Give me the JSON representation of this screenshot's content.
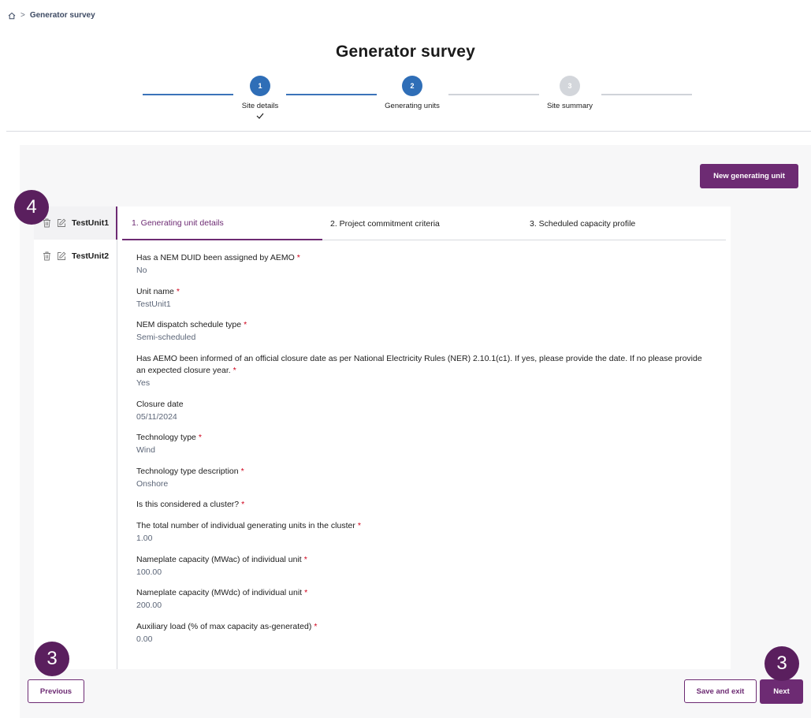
{
  "breadcrumb": {
    "current": "Generator survey"
  },
  "page_title": "Generator survey",
  "stepper": {
    "steps": [
      {
        "number": "1",
        "label": "Site details",
        "state": "completed"
      },
      {
        "number": "2",
        "label": "Generating units",
        "state": "current"
      },
      {
        "number": "3",
        "label": "Site summary",
        "state": "upcoming"
      }
    ]
  },
  "actions": {
    "new_unit": "New generating unit",
    "previous": "Previous",
    "save_exit": "Save and exit",
    "next": "Next"
  },
  "units": [
    {
      "name": "TestUnit1",
      "selected": true
    },
    {
      "name": "TestUnit2",
      "selected": false
    }
  ],
  "tabs": [
    {
      "label": "1. Generating unit details",
      "active": true
    },
    {
      "label": "2. Project commitment criteria",
      "active": false
    },
    {
      "label": "3. Scheduled capacity profile",
      "active": false
    }
  ],
  "fields": [
    {
      "label": "Has a NEM DUID been assigned by AEMO",
      "required": "*",
      "value": "No"
    },
    {
      "label": "Unit name",
      "required": "*",
      "value": "TestUnit1"
    },
    {
      "label": "NEM dispatch schedule type",
      "required": "*",
      "value": "Semi-scheduled"
    },
    {
      "label": "Has AEMO been informed of an official closure date as per National Electricity Rules (NER) 2.10.1(c1). If yes, please provide the date. If no please provide an expected closure year.",
      "required": "*",
      "value": "Yes"
    },
    {
      "label": "Closure date",
      "required": "",
      "value": "05/11/2024"
    },
    {
      "label": "Technology type",
      "required": "*",
      "value": "Wind"
    },
    {
      "label": "Technology type description",
      "required": "*",
      "value": "Onshore"
    },
    {
      "label": "Is this considered a cluster?",
      "required": "*",
      "value": ""
    },
    {
      "label": "The total number of individual generating units in the cluster",
      "required": "*",
      "value": "1.00"
    },
    {
      "label": "Nameplate capacity (MWac) of individual unit",
      "required": "*",
      "value": "100.00"
    },
    {
      "label": "Nameplate capacity (MWdc) of individual unit",
      "required": "*",
      "value": "200.00"
    },
    {
      "label": "Auxiliary load (% of max capacity as-generated)",
      "required": "*",
      "value": "0.00"
    }
  ],
  "annotations": {
    "unit_list": "4",
    "previous": "3",
    "next": "3"
  },
  "colors": {
    "brand": "#6d2b73",
    "step_active": "#2f6eb7",
    "required": "#d0021b"
  }
}
